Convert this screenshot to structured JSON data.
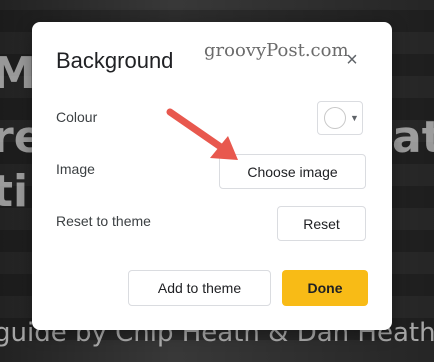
{
  "background_slide": {
    "line1": "Ma",
    "line2": "re",
    "line3": "ti",
    "right_fragment": "at",
    "footer": "guide by Chip Heath & Dan Heath"
  },
  "dialog": {
    "title": "Background",
    "watermark": "groovyPost.com",
    "close_icon": "close-icon",
    "close_glyph": "×",
    "colour": {
      "label": "Colour",
      "value_color": "#ffffff"
    },
    "image": {
      "label": "Image",
      "button_label": "Choose image"
    },
    "reset": {
      "label": "Reset to theme",
      "button_label": "Reset"
    },
    "footer": {
      "add_to_theme_label": "Add to theme",
      "done_label": "Done"
    }
  },
  "colors": {
    "done_accent": "#f8bb16",
    "annotation_arrow": "#e8584e"
  },
  "caret_glyph": "▼"
}
